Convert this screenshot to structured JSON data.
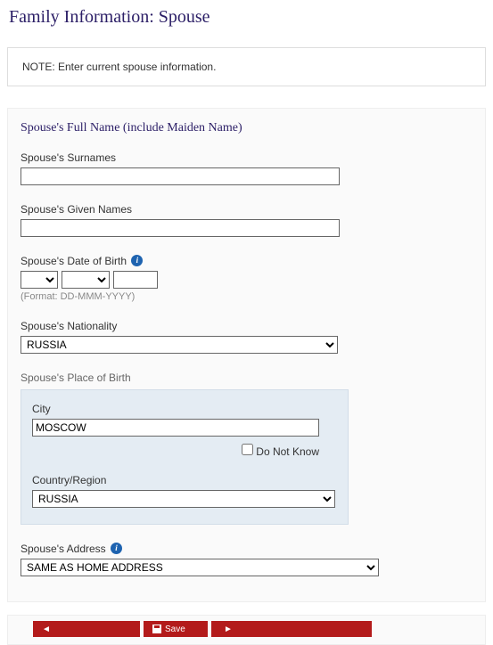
{
  "page_title": "Family Information: Spouse",
  "note": "NOTE: Enter current spouse information.",
  "section_title": "Spouse's Full Name (include Maiden Name)",
  "fields": {
    "surnames": {
      "label": "Spouse's Surnames",
      "value": ""
    },
    "given_names": {
      "label": "Spouse's Given Names",
      "value": ""
    },
    "dob": {
      "label": "Spouse's Date of Birth",
      "day": "",
      "month": "",
      "year": "",
      "hint": "(Format: DD-MMM-YYYY)"
    },
    "nationality": {
      "label": "Spouse's Nationality",
      "value": "RUSSIA"
    },
    "pob": {
      "label": "Spouse's Place of Birth",
      "city_label": "City",
      "city_value": "MOSCOW",
      "dnk_label": "Do Not Know",
      "dnk_checked": false,
      "country_label": "Country/Region",
      "country_value": "RUSSIA"
    },
    "address": {
      "label": "Spouse's Address",
      "value": "SAME AS HOME ADDRESS"
    }
  },
  "buttons": {
    "back": "",
    "save": "Save",
    "next": ""
  }
}
